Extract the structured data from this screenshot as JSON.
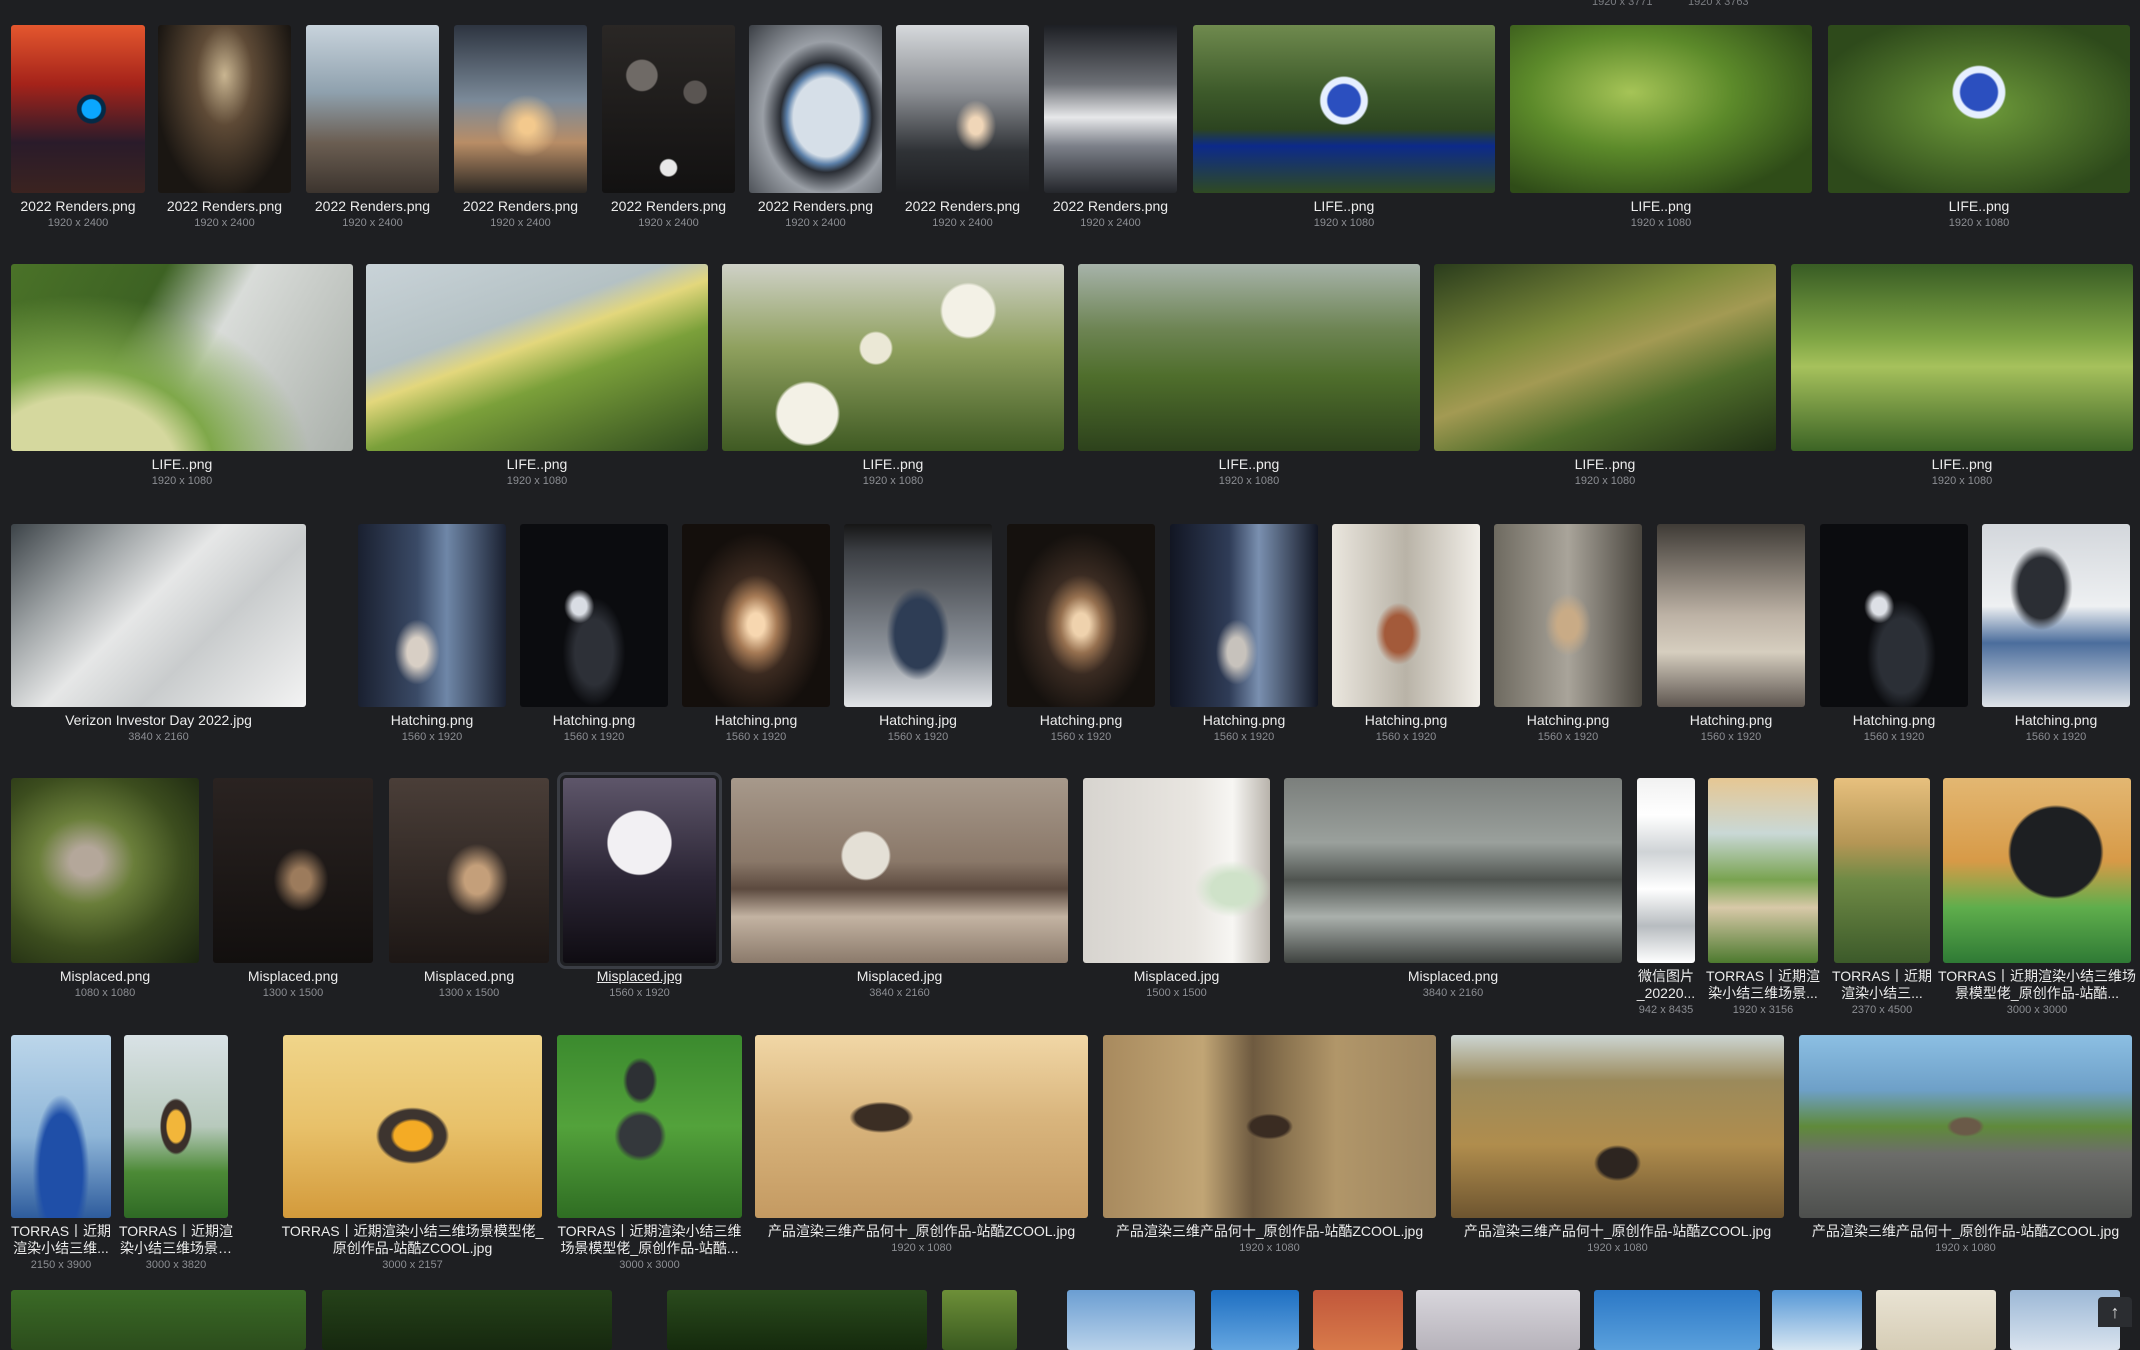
{
  "top_dims": [
    "1920 x 3771",
    "1920 x 3763"
  ],
  "rows": [
    {
      "items": [
        {
          "name": "2022 Renders.png",
          "dims": "1920 x 2400",
          "bg": "g-fire"
        },
        {
          "name": "2022 Renders.png",
          "dims": "1920 x 2400",
          "bg": "g-dark1"
        },
        {
          "name": "2022 Renders.png",
          "dims": "1920 x 2400",
          "bg": "g-rock"
        },
        {
          "name": "2022 Renders.png",
          "dims": "1920 x 2400",
          "bg": "g-sky"
        },
        {
          "name": "2022 Renders.png",
          "dims": "1920 x 2400",
          "bg": "g-bubble"
        },
        {
          "name": "2022 Renders.png",
          "dims": "1920 x 2400",
          "bg": "g-portal"
        },
        {
          "name": "2022 Renders.png",
          "dims": "1920 x 2400",
          "bg": "g-corridor"
        },
        {
          "name": "2022 Renders.png",
          "dims": "1920 x 2400",
          "bg": "g-mirror"
        },
        {
          "name": "LIFE..png",
          "dims": "1920 x 1080",
          "bg": "g-earth"
        },
        {
          "name": "LIFE..png",
          "dims": "1920 x 1080",
          "bg": "g-leaf"
        },
        {
          "name": "LIFE..png",
          "dims": "1920 x 1080",
          "bg": "g-earth2"
        }
      ]
    },
    {
      "items": [
        {
          "name": "LIFE..png",
          "dims": "1920 x 1080",
          "bg": "g-dome"
        },
        {
          "name": "LIFE..png",
          "dims": "1920 x 1080",
          "bg": "g-flowerslope"
        },
        {
          "name": "LIFE..png",
          "dims": "1920 x 1080",
          "bg": "g-daisy"
        },
        {
          "name": "LIFE..png",
          "dims": "1920 x 1080",
          "bg": "g-ruins"
        },
        {
          "name": "LIFE..png",
          "dims": "1920 x 1080",
          "bg": "g-moss"
        },
        {
          "name": "LIFE..png",
          "dims": "1920 x 1080",
          "bg": "g-field"
        }
      ]
    },
    {
      "items": [
        {
          "name": "Verizon Investor Day 2022.jpg",
          "dims": "3840 x 2160",
          "bg": "g-white"
        },
        {
          "name": "Hatching.png",
          "dims": "1560 x 1920",
          "bg": "g-hatchA"
        },
        {
          "name": "Hatching.png",
          "dims": "1560 x 1920",
          "bg": "g-hatchB"
        },
        {
          "name": "Hatching.png",
          "dims": "1560 x 1920",
          "bg": "g-hatchC"
        },
        {
          "name": "Hatching.jpg",
          "dims": "1560 x 1920",
          "bg": "g-hatchD"
        },
        {
          "name": "Hatching.png",
          "dims": "1560 x 1920",
          "bg": "g-hatchE"
        },
        {
          "name": "Hatching.png",
          "dims": "1560 x 1920",
          "bg": "g-hatchF"
        },
        {
          "name": "Hatching.png",
          "dims": "1560 x 1920",
          "bg": "g-hatchG"
        },
        {
          "name": "Hatching.png",
          "dims": "1560 x 1920",
          "bg": "g-hatchH"
        },
        {
          "name": "Hatching.png",
          "dims": "1560 x 1920",
          "bg": "g-hatchI"
        },
        {
          "name": "Hatching.png",
          "dims": "1560 x 1920",
          "bg": "g-hatchJ"
        },
        {
          "name": "Hatching.png",
          "dims": "1560 x 1920",
          "bg": "g-hatchK"
        }
      ]
    },
    {
      "items": [
        {
          "name": "Misplaced.png",
          "dims": "1080 x 1080",
          "bg": "g-misA"
        },
        {
          "name": "Misplaced.png",
          "dims": "1300 x 1500",
          "bg": "g-misB"
        },
        {
          "name": "Misplaced.png",
          "dims": "1300 x 1500",
          "bg": "g-misC"
        },
        {
          "name": "Misplaced.jpg",
          "dims": "1560 x 1920",
          "bg": "g-moon",
          "selected": true
        },
        {
          "name": "Misplaced.jpg",
          "dims": "3840 x 2160",
          "bg": "g-moonwide"
        },
        {
          "name": "Misplaced.jpg",
          "dims": "1500 x 1500",
          "bg": "g-room"
        },
        {
          "name": "Misplaced.png",
          "dims": "3840 x 2160",
          "bg": "g-lake"
        },
        {
          "name": "微信图片_20220...",
          "dims": "942 x 8435",
          "bg": "g-phone",
          "wrap": true
        },
        {
          "name": "TORRAS丨近期渲染小结三维场景...",
          "dims": "1920 x 3156",
          "bg": "g-path",
          "wrap": true
        },
        {
          "name": "TORRAS丨近期渲染小结三...",
          "dims": "2370 x 4500",
          "bg": "g-car",
          "wrap": true
        },
        {
          "name": "TORRAS丨近期渲染小结三维场景模型佬_原创作品-站酷...",
          "dims": "3000 x 3000",
          "bg": "g-umbrella",
          "wrap": true
        }
      ]
    },
    {
      "items": [
        {
          "name": "TORRAS丨近期渲染小结三维...",
          "dims": "2150 x 3900",
          "bg": "g-pens",
          "wrap": true
        },
        {
          "name": "TORRAS丨近期渲染小结三维场景模型佬_原...",
          "dims": "3000 x 3820",
          "bg": "g-lamp1",
          "wrap": true
        },
        {
          "name": "TORRAS丨近期渲染小结三维场景模型佬_原创作品-站酷ZCOOL.jpg",
          "dims": "3000 x 2157",
          "bg": "g-lamp2",
          "wrap": true
        },
        {
          "name": "TORRAS丨近期渲染小结三维场景模型佬_原创作品-站酷...",
          "dims": "3000 x 3000",
          "bg": "g-grass",
          "wrap": true
        },
        {
          "name": "产品渲染三维产品何十_原创作品-站酷ZCOOL.jpg",
          "dims": "1920 x 1080",
          "bg": "g-sand"
        },
        {
          "name": "产品渲染三维产品何十_原创作品-站酷ZCOOL.jpg",
          "dims": "1920 x 1080",
          "bg": "g-hay"
        },
        {
          "name": "产品渲染三维产品何十_原创作品-站酷ZCOOL.jpg",
          "dims": "1920 x 1080",
          "bg": "g-wheat"
        },
        {
          "name": "产品渲染三维产品何十_原创作品-站酷ZCOOL.jpg",
          "dims": "1920 x 1080",
          "bg": "g-wall"
        }
      ]
    },
    {
      "items": [
        {
          "bg": "g-b1"
        },
        {
          "bg": "g-b2"
        },
        {
          "bg": "g-b3"
        },
        {
          "bg": "g-b4"
        },
        {
          "bg": "g-b5"
        },
        {
          "bg": "g-b6"
        },
        {
          "bg": "g-b7"
        },
        {
          "bg": "g-b8"
        },
        {
          "bg": "g-b9"
        },
        {
          "bg": "g-b10"
        },
        {
          "bg": "g-b11"
        },
        {
          "bg": "g-b12"
        }
      ]
    }
  ],
  "scroll_top_icon": "arrow-up-icon"
}
